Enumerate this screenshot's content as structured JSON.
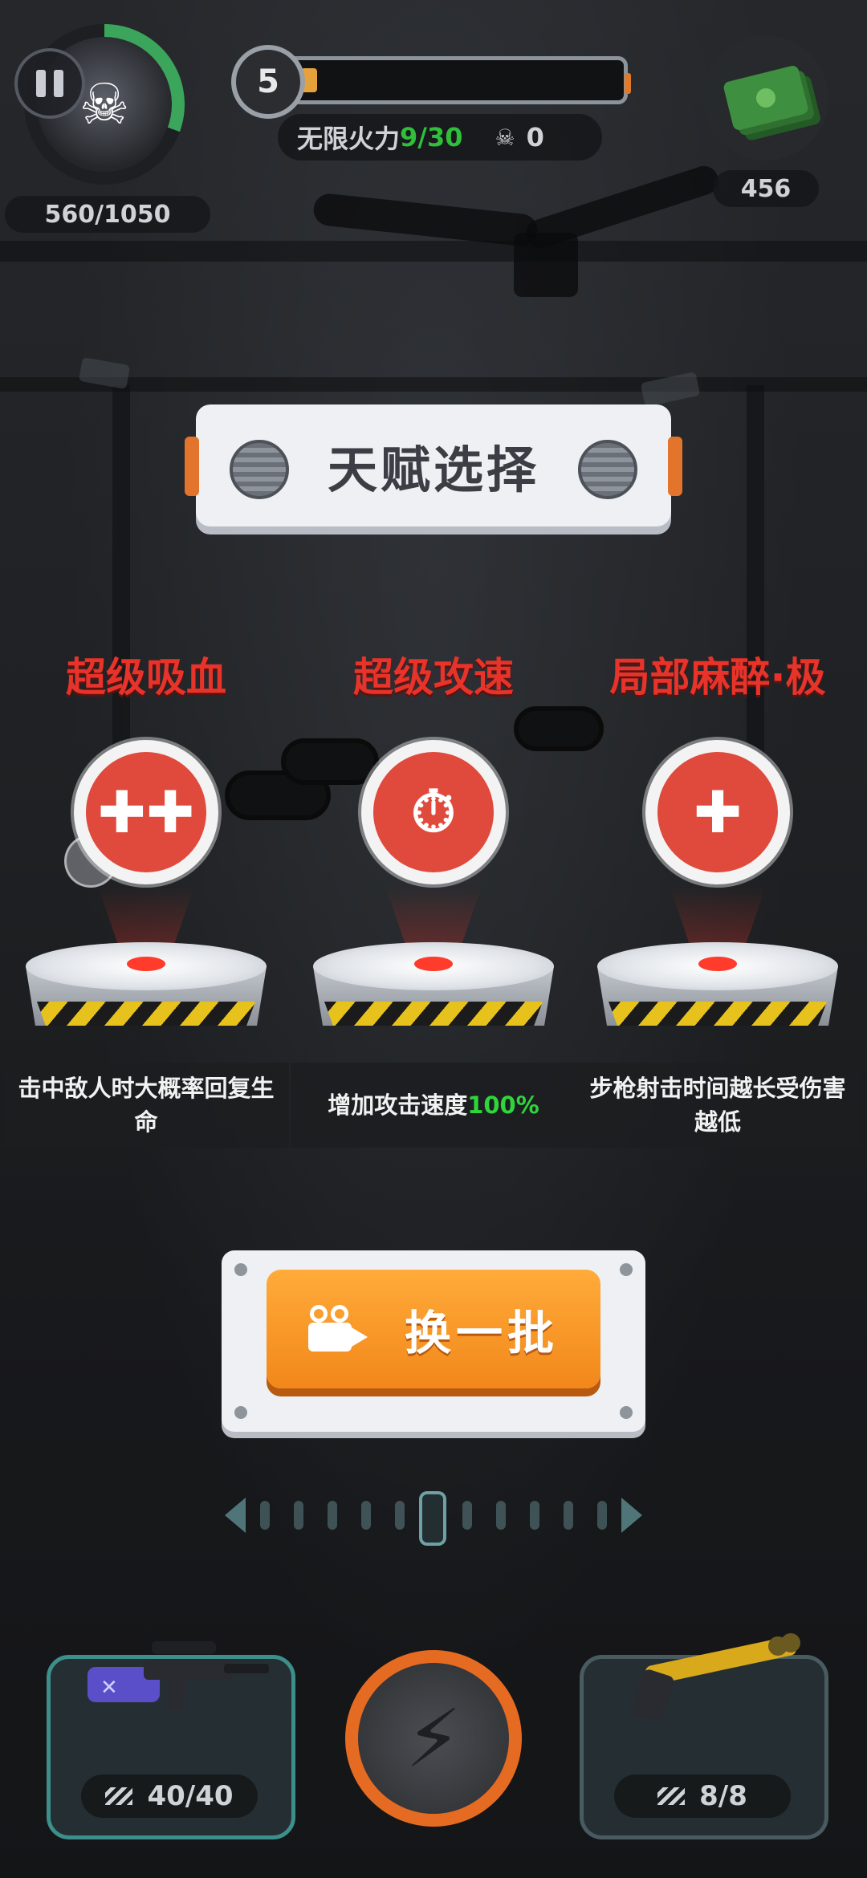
{
  "hud": {
    "hp": "560/1050",
    "level": "5",
    "xp_progress": 0.05,
    "mode_label": "无限火力",
    "mode_count": "9/30",
    "kills": "0",
    "cash": "456",
    "icons": [
      "pause-icon",
      "avatar-skull-icon",
      "skull-icon",
      "cash-icon"
    ]
  },
  "title": "天赋选择",
  "talents": [
    {
      "name": "超级吸血",
      "icon": "heal-plus-icon",
      "desc": "击中敌人时大概率回复生命",
      "desc_highlight": ""
    },
    {
      "name": "超级攻速",
      "icon": "stopwatch-gun-icon",
      "desc": "增加攻击速度",
      "desc_highlight": "100%"
    },
    {
      "name": "局部麻醉·极",
      "icon": "shield-cross-icon",
      "desc": "步枪射击时间越长受伤害越低",
      "desc_highlight": ""
    }
  ],
  "refresh_button": {
    "label": "换一批",
    "icon": "video-camera-icon"
  },
  "weapons": {
    "left_ammo": "40/40",
    "right_ammo": "8/8",
    "skill_icon": "lightning-icon"
  },
  "colors": {
    "talent_red": "#e8332a",
    "highlight_green": "#2fd53b",
    "button_orange": "#f2871a",
    "hp_green": "#3aa55b"
  }
}
